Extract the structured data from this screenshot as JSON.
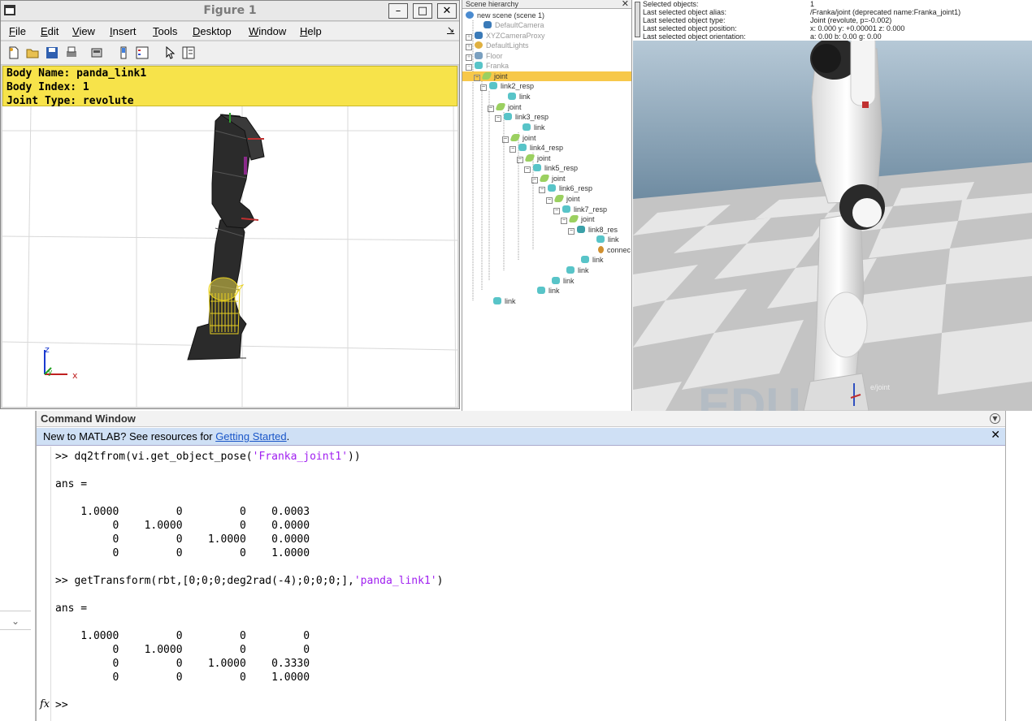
{
  "figure": {
    "title": "Figure 1",
    "menu": [
      "File",
      "Edit",
      "View",
      "Insert",
      "Tools",
      "Desktop",
      "Window",
      "Help"
    ],
    "info": {
      "line1": "Body Name: panda_link1",
      "line2": "Body Index: 1",
      "line3": "Joint Type: revolute"
    },
    "axes": {
      "x": "x",
      "y": "y",
      "z": "z"
    },
    "highlight_color": "#f7e34a"
  },
  "scene_hierarchy": {
    "title": "Scene hierarchy",
    "items": [
      {
        "label": "new scene (scene 1)"
      },
      {
        "label": "DefaultCamera"
      },
      {
        "label": "XYZCameraProxy"
      },
      {
        "label": "DefaultLights"
      },
      {
        "label": "Floor"
      },
      {
        "label": "Franka"
      },
      {
        "label": "joint"
      },
      {
        "label": "link2_resp"
      },
      {
        "label": "link"
      },
      {
        "label": "joint"
      },
      {
        "label": "link3_resp"
      },
      {
        "label": "link"
      },
      {
        "label": "joint"
      },
      {
        "label": "link4_resp"
      },
      {
        "label": "joint"
      },
      {
        "label": "link5_resp"
      },
      {
        "label": "joint"
      },
      {
        "label": "link6_resp"
      },
      {
        "label": "joint"
      },
      {
        "label": "link7_resp"
      },
      {
        "label": "joint"
      },
      {
        "label": "link8_res"
      },
      {
        "label": "link"
      },
      {
        "label": "connec"
      },
      {
        "label": "link"
      },
      {
        "label": "link"
      },
      {
        "label": "link"
      },
      {
        "label": "link"
      },
      {
        "label": "link"
      }
    ]
  },
  "view": {
    "info_labels": [
      "Selected objects:",
      "Last selected object alias:",
      "Last selected object type:",
      "Last selected object position:",
      "Last selected object orientation:"
    ],
    "info_values": [
      "1",
      "/Franka/joint   (deprecated name:Franka_joint1)",
      "Joint (revolute, p=-0.002)",
      "x: 0.000   y: +0.00001   z: 0.000",
      "a: 0.00    b: 0.00    g: 0.00"
    ],
    "object_label": "e/joint",
    "watermark": "EDU"
  },
  "command_window": {
    "title": "Command Window",
    "banner_text": "New to MATLAB? See resources for ",
    "banner_link": "Getting Started",
    "banner_end": ".",
    "cmd1_prefix": ">> dq2tfrom(vi.get_object_pose(",
    "cmd1_str": "'Franka_joint1'",
    "cmd1_suffix": "))",
    "ans1": "ans =",
    "m1": [
      "    1.0000         0         0    0.0003",
      "         0    1.0000         0    0.0000",
      "         0         0    1.0000    0.0000",
      "         0         0         0    1.0000"
    ],
    "cmd2_prefix": ">> getTransform(rbt,[0;0;0;deg2rad(-4);0;0;0;],",
    "cmd2_str": "'panda_link1'",
    "cmd2_suffix": ")",
    "ans2": "ans =",
    "m2": [
      "    1.0000         0         0         0",
      "         0    1.0000         0         0",
      "         0         0    1.0000    0.3330",
      "         0         0         0    1.0000"
    ],
    "prompt": ">>",
    "fx": "fx"
  }
}
